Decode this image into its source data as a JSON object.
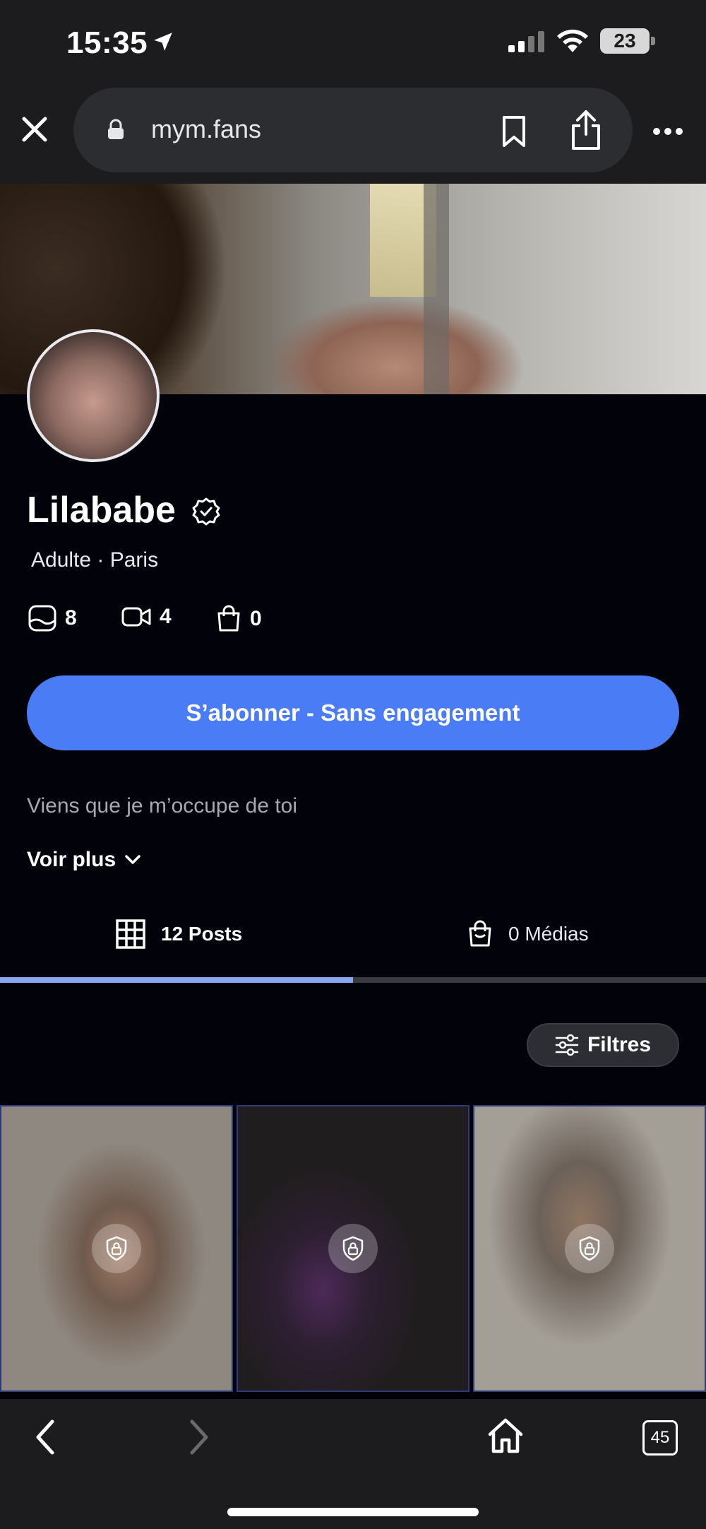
{
  "status_bar": {
    "time": "15:35",
    "battery": "23",
    "icons": [
      "location-arrow-icon",
      "signal-bars-icon",
      "wifi-icon",
      "battery-icon"
    ]
  },
  "browser": {
    "url": "mym.fans",
    "tab_count": "45",
    "icons": [
      "close-icon",
      "lock-icon",
      "bookmark-icon",
      "share-icon",
      "more-icon",
      "back-icon",
      "forward-icon",
      "home-icon",
      "tabs-icon"
    ]
  },
  "profile": {
    "name": "Lilababe",
    "meta": "Adulte · Paris",
    "stats": {
      "photos": "8",
      "videos": "4",
      "purchases": "0"
    },
    "subscribe_label": "S’abonner - Sans engagement",
    "bio": "Viens que je m’occupe de toi",
    "see_more": "Voir plus"
  },
  "tabs": {
    "posts": "12 Posts",
    "medias": "0 Médias",
    "active_index": 0
  },
  "filters_label": "Filtres",
  "colors": {
    "accent": "#4a7cf5",
    "background": "#02030a",
    "chrome": "#1c1c1e",
    "tab_indicator": "#8aa6ee"
  }
}
